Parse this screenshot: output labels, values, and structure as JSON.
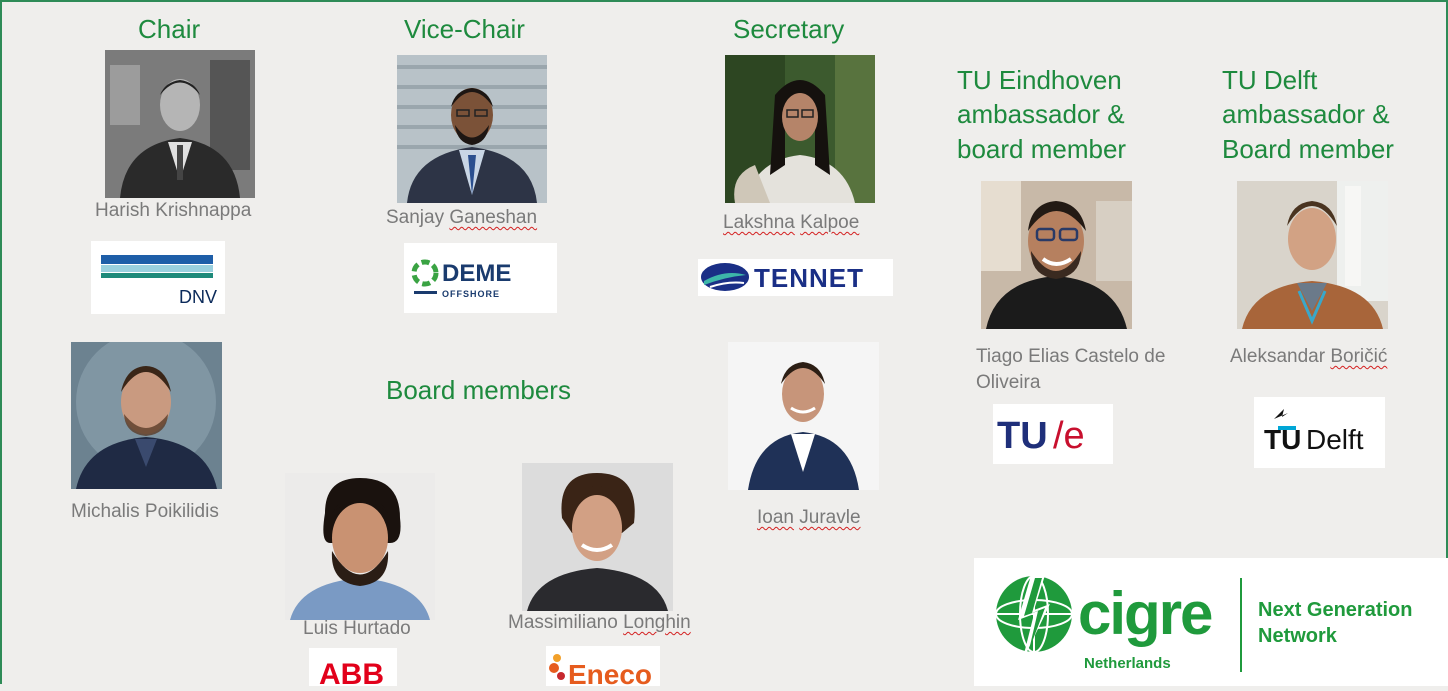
{
  "roles": {
    "chair": "Chair",
    "vice_chair": "Vice-Chair",
    "secretary": "Secretary",
    "tue_line1": "TU Eindhoven",
    "tue_line2": "ambassador &",
    "tue_line3": "board member",
    "tud_line1": "TU Delft",
    "tud_line2": "ambassador &",
    "tud_line3": "Board member",
    "board_members": "Board members"
  },
  "people": {
    "chair_first": "Harish",
    "chair_last": "Krishnappa",
    "vice_first": "Sanjay",
    "vice_last": "Ganeshan",
    "secretary_first": "Lakshna",
    "secretary_last": "Kalpoe",
    "tue_line1": "Tiago Elias Castelo de",
    "tue_line2": "Oliveira",
    "tud_first": "Aleksandar",
    "tud_last": "Boričić",
    "board_1": "Michalis Poikilidis",
    "board_2": "Luis Hurtado",
    "board_3_first": "Massimiliano",
    "board_3_last": "Longhin",
    "board_4_first": "Ioan",
    "board_4_last": "Juravle"
  },
  "logos": {
    "dnv": "DNV",
    "deme_main": "DEME",
    "deme_sub": "OFFSHORE",
    "tennet": "TENNET",
    "tue_a": "TU",
    "tue_b": "/e",
    "tud_a": "TU",
    "tud_b": "Delft",
    "abb": "ABB",
    "eneco": "Eneco",
    "cigre_word": "cigre",
    "cigre_country": "Netherlands",
    "ngn_line1": "Next Generation",
    "ngn_line2": "Network"
  },
  "colors": {
    "role_green": "#1e8a3e",
    "name_grey": "#7a7a7a",
    "frame_green": "#2e8b57",
    "background": "#efeeec",
    "cigre_green": "#1f9a3c",
    "tennet_blue": "#1a2f86",
    "abb_red": "#e2001a",
    "eneco_orange": "#e65c1e"
  }
}
